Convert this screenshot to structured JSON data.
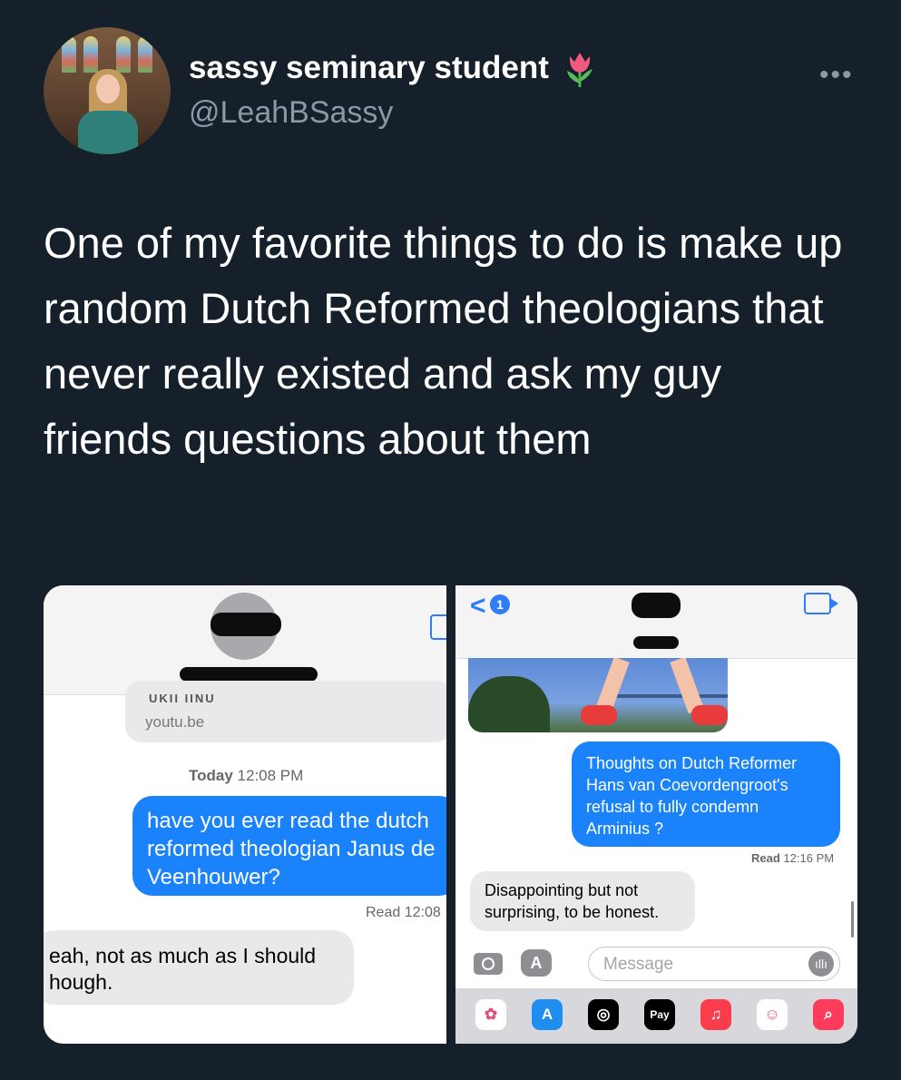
{
  "profile": {
    "display_name": "sassy seminary student",
    "handle": "@LeahBSassy",
    "more_label": "•••"
  },
  "tweet": {
    "text": "One of my favorite things to do is make up random Dutch Reformed theologians that never really existed and ask my guy friends questions about them"
  },
  "left_screenshot": {
    "link_card_cut_title": "UKII IINU",
    "link_card_source": "youtu.be",
    "timestamp_day": "Today",
    "timestamp_time": "12:08 PM",
    "outgoing_message": "have you ever read the dutch reformed theologian Janus de Veenhouwer?",
    "read_receipt": "Read 12:08",
    "incoming_message": "eah, not as much as I should hough."
  },
  "right_screenshot": {
    "back_glyph": "<",
    "back_badge": "1",
    "outgoing_message": "Thoughts on Dutch Reformer Hans van Coevordengroot's refusal to fully condemn Arminius ?",
    "read_label": "Read",
    "read_time": "12:16 PM",
    "incoming_message": "Disappointing but not surprising, to be honest.",
    "input_placeholder": "Message",
    "apps_glyph": "A",
    "audio_glyph": "ıllı",
    "tray": [
      {
        "name": "photos-icon",
        "color": "#ffffff",
        "glyph": "✿"
      },
      {
        "name": "app-store-icon",
        "color": "#1f8ef1",
        "glyph": "A"
      },
      {
        "name": "fitness-icon",
        "color": "#000000",
        "glyph": "◎"
      },
      {
        "name": "apple-pay-icon",
        "color": "#000000",
        "glyph": "Pay"
      },
      {
        "name": "music-icon",
        "color": "#fa3c4c",
        "glyph": "♫"
      },
      {
        "name": "memoji-icon",
        "color": "#ffffff",
        "glyph": "☺"
      },
      {
        "name": "search-images-icon",
        "color": "#ff3b5c",
        "glyph": "⌕"
      }
    ]
  },
  "colors": {
    "background": "#15202b",
    "imessage_blue": "#1a82fb",
    "incoming_gray": "#e9e9eb",
    "muted_text": "#8b98a5"
  }
}
